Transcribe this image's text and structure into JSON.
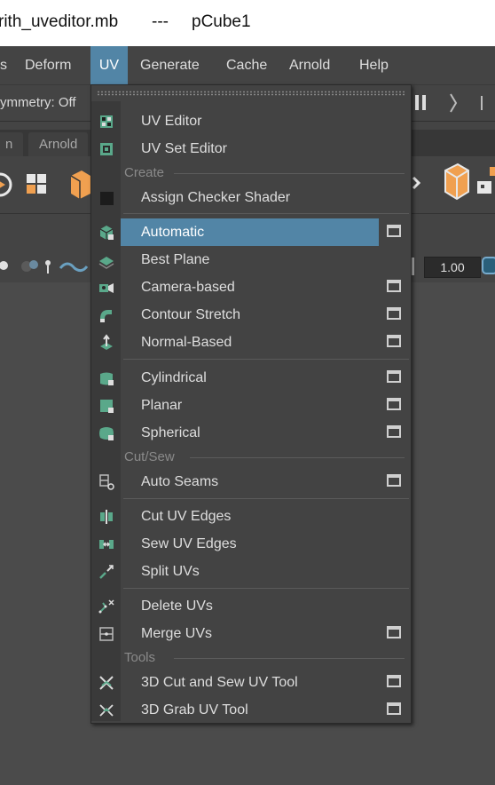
{
  "title_bar": {
    "filename": "rith_uveditor.mb",
    "separator": "---",
    "object": "pCube1"
  },
  "menubar": {
    "items": [
      "s",
      "Deform",
      "UV",
      "Generate",
      "Cache",
      "Arnold",
      "Help"
    ],
    "active": "UV"
  },
  "status_line": {
    "symmetry": "ymmetry: Off"
  },
  "shelf_tabs": [
    "n",
    "Arnold"
  ],
  "toolbar": {
    "value": "1.00"
  },
  "uv_menu": {
    "items": [
      {
        "label": "UV Editor",
        "icon": "uv-editor-icon",
        "option_box": false
      },
      {
        "label": "UV Set Editor",
        "icon": "uv-set-editor-icon",
        "option_box": false
      },
      {
        "section": "Create"
      },
      {
        "label": "Assign Checker Shader",
        "icon": "checker-shader-icon",
        "option_box": false
      },
      {
        "label": "Automatic",
        "icon": "automatic-mapping-icon",
        "option_box": true,
        "highlighted": true
      },
      {
        "label": "Best Plane",
        "icon": "best-plane-icon",
        "option_box": false
      },
      {
        "label": "Camera-based",
        "icon": "camera-based-icon",
        "option_box": true
      },
      {
        "label": "Contour Stretch",
        "icon": "contour-stretch-icon",
        "option_box": true
      },
      {
        "label": "Normal-Based",
        "icon": "normal-based-icon",
        "option_box": true
      },
      {
        "label": "Cylindrical",
        "icon": "cylindrical-icon",
        "option_box": true
      },
      {
        "label": "Planar",
        "icon": "planar-icon",
        "option_box": true
      },
      {
        "label": "Spherical",
        "icon": "spherical-icon",
        "option_box": true
      },
      {
        "section": "Cut/Sew"
      },
      {
        "label": "Auto Seams",
        "icon": "auto-seams-icon",
        "option_box": true
      },
      {
        "label": "Cut UV Edges",
        "icon": "cut-uv-edges-icon",
        "option_box": false
      },
      {
        "label": "Sew UV Edges",
        "icon": "sew-uv-edges-icon",
        "option_box": false
      },
      {
        "label": "Split UVs",
        "icon": "split-uvs-icon",
        "option_box": false
      },
      {
        "label": "Delete UVs",
        "icon": "delete-uvs-icon",
        "option_box": false
      },
      {
        "label": "Merge UVs",
        "icon": "merge-uvs-icon",
        "option_box": true
      },
      {
        "section": "Tools"
      },
      {
        "label": "3D Cut and Sew UV Tool",
        "icon": "cut-sew-tool-icon",
        "option_box": true
      },
      {
        "label": "3D Grab UV Tool",
        "icon": "grab-uv-tool-icon",
        "option_box": true
      }
    ]
  },
  "colors": {
    "highlight": "#5285a6",
    "menu_bg": "#434343",
    "icon_green": "#5aa88a"
  }
}
